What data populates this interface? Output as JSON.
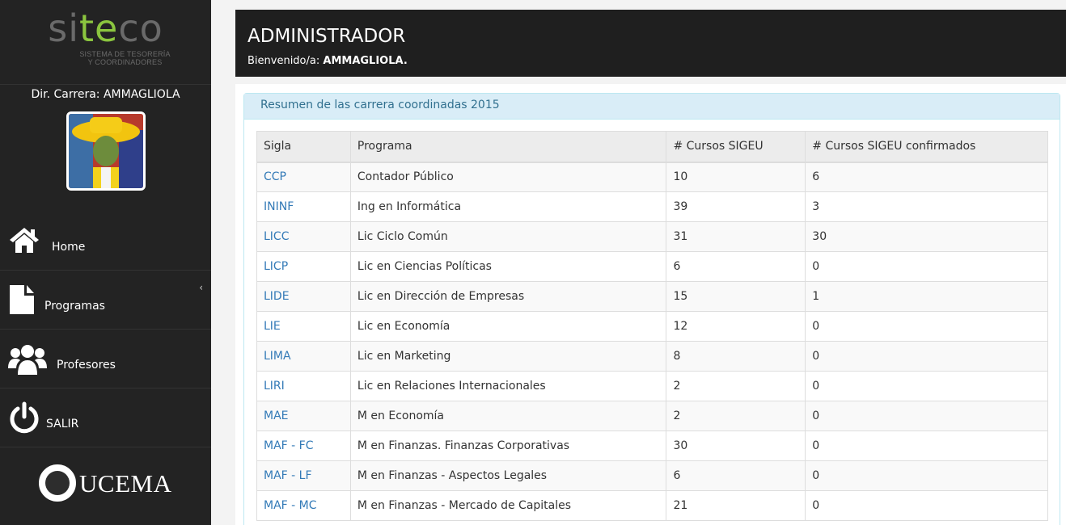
{
  "sidebar": {
    "logo": {
      "word_a": "si",
      "word_b": "te",
      "word_c": "co",
      "sub1": "SISTEMA DE TESORERÍA",
      "sub2": "Y COORDINADORES"
    },
    "dir_label": "Dir. Carrera: AMMAGLIOLA",
    "nav": [
      {
        "label": "Home",
        "icon": "home-icon"
      },
      {
        "label": "Programas",
        "icon": "document-icon",
        "chevron": "‹"
      },
      {
        "label": "Profesores",
        "icon": "users-icon"
      },
      {
        "label": "SALIR",
        "icon": "power-icon"
      }
    ],
    "footer_logo": "UCEMA"
  },
  "header": {
    "title": "ADMINISTRADOR",
    "welcome_prefix": "Bienvenido/a:",
    "welcome_user": "AMMAGLIOLA."
  },
  "panel": {
    "title": "Resumen de las carrera coordinadas 2015",
    "columns": [
      "Sigla",
      "Programa",
      "# Cursos SIGEU",
      "# Cursos SIGEU confirmados"
    ],
    "rows": [
      [
        "CCP",
        "Contador Público",
        "10",
        "6"
      ],
      [
        "ININF",
        "Ing en Informática",
        "39",
        "3"
      ],
      [
        "LICC",
        "Lic Ciclo Común",
        "31",
        "30"
      ],
      [
        "LICP",
        "Lic en Ciencias Políticas",
        "6",
        "0"
      ],
      [
        "LIDE",
        "Lic en Dirección de Empresas",
        "15",
        "1"
      ],
      [
        "LIE",
        "Lic en Economía",
        "12",
        "0"
      ],
      [
        "LIMA",
        "Lic en Marketing",
        "8",
        "0"
      ],
      [
        "LIRI",
        "Lic en Relaciones Internacionales",
        "2",
        "0"
      ],
      [
        "MAE",
        "M en Economía",
        "2",
        "0"
      ],
      [
        "MAF - FC",
        "M en Finanzas. Finanzas Corporativas",
        "30",
        "0"
      ],
      [
        "MAF - LF",
        "M en Finanzas - Aspectos Legales",
        "6",
        "0"
      ],
      [
        "MAF - MC",
        "M en Finanzas - Mercado de Capitales",
        "21",
        "0"
      ]
    ]
  },
  "colors": {
    "sidebar_bg": "#232323",
    "brand_green": "#8bc53f",
    "link": "#337ab7",
    "panel_head_bg": "#d9edf7"
  }
}
